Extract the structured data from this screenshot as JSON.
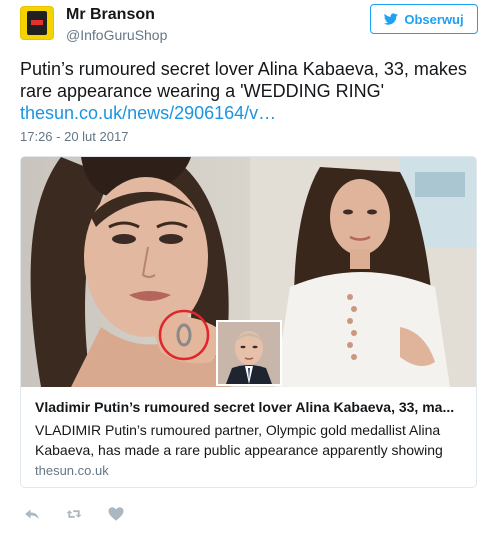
{
  "author": {
    "name": "Mr Branson",
    "handle": "@InfoGuruShop"
  },
  "follow_button": {
    "label": "Obserwuj",
    "icon": "twitter-bird-icon"
  },
  "tweet": {
    "text": "Putin’s rumoured secret lover Alina Kabaeva, 33, makes rare appearance wearing a 'WEDDING RING'",
    "link": "thesun.co.uk/news/2906164/v…",
    "timestamp": "17:26 - 20 lut 2017"
  },
  "card": {
    "title": "Vladimir Putin’s rumoured secret lover Alina Kabaeva, 33, ma...",
    "description": "VLADIMIR Putin’s rumoured partner, Olympic gold medallist Alina Kabaeva, has made a rare public appearance apparently showing",
    "domain": "thesun.co.uk"
  },
  "actions": [
    "reply-icon",
    "retweet-icon",
    "like-heart-icon"
  ],
  "colors": {
    "link": "#1b95e0",
    "accent": "#1da1f2",
    "muted": "#657786",
    "highlight_circle": "#e0262b"
  }
}
